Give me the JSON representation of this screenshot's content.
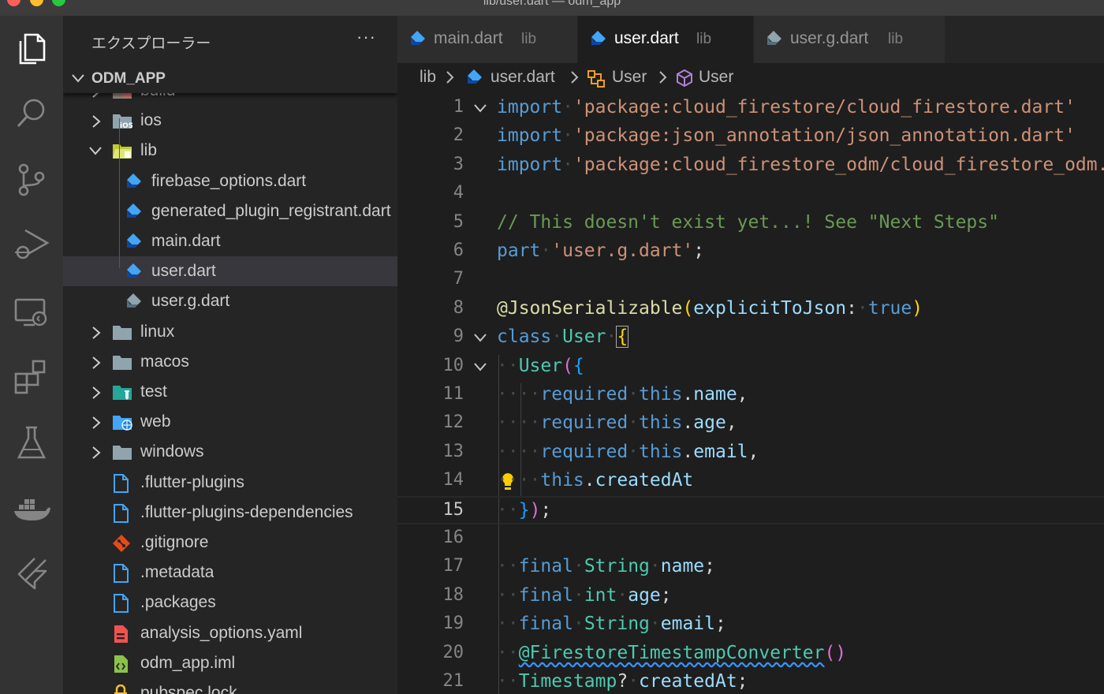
{
  "window": {
    "title": "lib/user.dart — odm_app"
  },
  "colors": {
    "accent": "#007acc",
    "dart_blue": "#42a5f5",
    "selection": "#37373d",
    "keyword": "#569cd6",
    "string": "#ce9178",
    "comment": "#6a9955",
    "type": "#4ec9b0"
  },
  "activity_bar": [
    "files-icon",
    "search-icon",
    "source-control-icon",
    "run-debug-icon",
    "remote-explorer-icon",
    "extensions-icon",
    "testing-icon",
    "docker-icon",
    "flutter-icon"
  ],
  "sidebar": {
    "title": "エクスプローラー",
    "more": "···",
    "section": "ODM_APP",
    "items": [
      {
        "label": "build",
        "icon": "folder-build-icon",
        "folder": true,
        "expanded": false,
        "depth": 1
      },
      {
        "label": "ios",
        "icon": "folder-ios-icon",
        "folder": true,
        "expanded": false,
        "depth": 1
      },
      {
        "label": "lib",
        "icon": "folder-lib-open-icon",
        "folder": true,
        "expanded": true,
        "depth": 1
      },
      {
        "label": "firebase_options.dart",
        "icon": "dart-file-icon",
        "folder": false,
        "depth": 2
      },
      {
        "label": "generated_plugin_registrant.dart",
        "icon": "dart-file-icon",
        "folder": false,
        "depth": 2
      },
      {
        "label": "main.dart",
        "icon": "dart-file-icon",
        "folder": false,
        "depth": 2
      },
      {
        "label": "user.dart",
        "icon": "dart-file-icon",
        "folder": false,
        "depth": 2,
        "selected": true
      },
      {
        "label": "user.g.dart",
        "icon": "dart-generated-file-icon",
        "folder": false,
        "depth": 2
      },
      {
        "label": "linux",
        "icon": "folder-icon",
        "folder": true,
        "expanded": false,
        "depth": 1
      },
      {
        "label": "macos",
        "icon": "folder-icon",
        "folder": true,
        "expanded": false,
        "depth": 1
      },
      {
        "label": "test",
        "icon": "folder-test-icon",
        "folder": true,
        "expanded": false,
        "depth": 1
      },
      {
        "label": "web",
        "icon": "folder-web-icon",
        "folder": true,
        "expanded": false,
        "depth": 1
      },
      {
        "label": "windows",
        "icon": "folder-icon",
        "folder": true,
        "expanded": false,
        "depth": 1
      },
      {
        "label": ".flutter-plugins",
        "icon": "file-icon",
        "folder": false,
        "depth": 1
      },
      {
        "label": ".flutter-plugins-dependencies",
        "icon": "file-icon",
        "folder": false,
        "depth": 1
      },
      {
        "label": ".gitignore",
        "icon": "git-icon",
        "folder": false,
        "depth": 1
      },
      {
        "label": ".metadata",
        "icon": "file-icon",
        "folder": false,
        "depth": 1
      },
      {
        "label": ".packages",
        "icon": "file-icon",
        "folder": false,
        "depth": 1
      },
      {
        "label": "analysis_options.yaml",
        "icon": "yaml-icon",
        "folder": false,
        "depth": 1
      },
      {
        "label": "odm_app.iml",
        "icon": "iml-icon",
        "folder": false,
        "depth": 1
      },
      {
        "label": "pubspec.lock",
        "icon": "lock-icon",
        "folder": false,
        "depth": 1
      }
    ]
  },
  "tabs": [
    {
      "name": "main.dart",
      "desc": "lib",
      "active": false,
      "icon": "dart-file-icon"
    },
    {
      "name": "user.dart",
      "desc": "lib",
      "active": true,
      "icon": "dart-file-icon"
    },
    {
      "name": "user.g.dart",
      "desc": "lib",
      "active": false,
      "icon": "dart-generated-file-icon"
    }
  ],
  "breadcrumb": [
    "lib",
    "user.dart",
    "User",
    "User"
  ],
  "editor": {
    "current_line": 15,
    "lines": [
      {
        "n": "1",
        "fold": true
      },
      {
        "n": "2"
      },
      {
        "n": "3"
      },
      {
        "n": "4"
      },
      {
        "n": "5"
      },
      {
        "n": "6"
      },
      {
        "n": "7"
      },
      {
        "n": "8"
      },
      {
        "n": "9",
        "fold": true
      },
      {
        "n": "10",
        "fold": true
      },
      {
        "n": "11"
      },
      {
        "n": "12"
      },
      {
        "n": "13"
      },
      {
        "n": "14"
      },
      {
        "n": "15"
      },
      {
        "n": "16"
      },
      {
        "n": "17"
      },
      {
        "n": "18"
      },
      {
        "n": "19"
      },
      {
        "n": "20"
      },
      {
        "n": "21"
      }
    ],
    "tokens": {
      "import": "import",
      "imp1": "'package:cloud_firestore/cloud_firestore.dart'",
      "imp2": "'package:json_annotation/json_annotation.dart'",
      "imp3": "'package:cloud_firestore_odm/cloud_firestore_odm.dart'",
      "comment": "// This doesn't exist yet...! See \"Next Steps\"",
      "part": "part",
      "part_str": "'user.g.dart'",
      "annotation": "@JsonSerializable",
      "named_arg": "explicitToJson",
      "true": "true",
      "class": "class",
      "class_name": "User",
      "ctor": "User",
      "required": "required",
      "this": "this",
      "f_name": "name",
      "f_age": "age",
      "f_email": "email",
      "f_created": "createdAt",
      "final": "final",
      "t_string": "String",
      "t_int": "int",
      "ts_annotation": "@FirestoreTimestampConverter",
      "t_timestamp": "Timestamp"
    }
  }
}
